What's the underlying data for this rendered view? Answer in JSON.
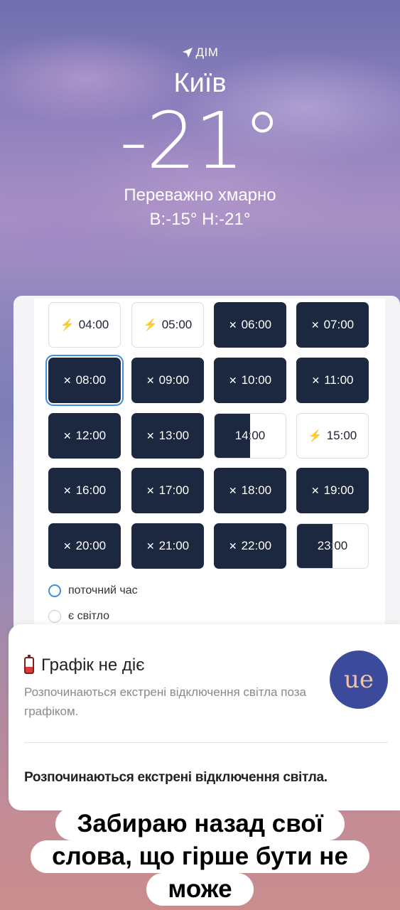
{
  "weather": {
    "location_label": "ДІМ",
    "city": "Київ",
    "temperature": "-21°",
    "condition": "Переважно хмарно",
    "high_low": "В:-15°  Н:-21°"
  },
  "schedule": {
    "slots": [
      {
        "time": "04:00",
        "state": "on"
      },
      {
        "time": "05:00",
        "state": "on"
      },
      {
        "time": "06:00",
        "state": "off"
      },
      {
        "time": "07:00",
        "state": "off"
      },
      {
        "time": "08:00",
        "state": "off",
        "selected": true
      },
      {
        "time": "09:00",
        "state": "off"
      },
      {
        "time": "10:00",
        "state": "off"
      },
      {
        "time": "11:00",
        "state": "off"
      },
      {
        "time": "12:00",
        "state": "off"
      },
      {
        "time": "13:00",
        "state": "off"
      },
      {
        "time": "14:00",
        "state": "half"
      },
      {
        "time": "15:00",
        "state": "on"
      },
      {
        "time": "16:00",
        "state": "off"
      },
      {
        "time": "17:00",
        "state": "off"
      },
      {
        "time": "18:00",
        "state": "off"
      },
      {
        "time": "19:00",
        "state": "off"
      },
      {
        "time": "20:00",
        "state": "off"
      },
      {
        "time": "21:00",
        "state": "off"
      },
      {
        "time": "22:00",
        "state": "off"
      },
      {
        "time": "23:00",
        "state": "half"
      }
    ],
    "legend_current": "поточний час",
    "legend_power": "є світло",
    "colors": {
      "off": "#1c2840",
      "accent": "#3b8ee3",
      "bolt": "#f2b534"
    }
  },
  "notification": {
    "icon": "battery-low-icon",
    "title": "Графік не діє",
    "body": "Розпочинаються екстрені відключення світла поза графіком.",
    "app_icon": "app-logo-icon",
    "app_logo_text": "ue",
    "message": "Розпочинаються екстрені відключення світла."
  },
  "caption": {
    "line1": "Забираю назад свої",
    "line2": "слова, що гірше бути не",
    "line3": "може"
  }
}
